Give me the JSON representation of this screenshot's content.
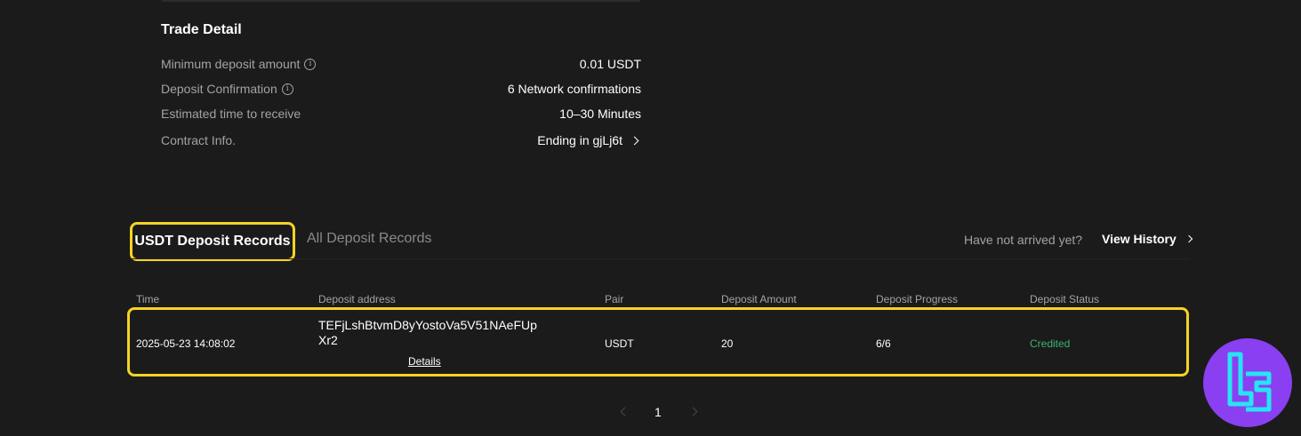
{
  "trade_detail": {
    "title": "Trade Detail",
    "rows": [
      {
        "label": "Minimum deposit amount",
        "value": "0.01 USDT"
      },
      {
        "label": "Deposit Confirmation",
        "value": "6 Network confirmations"
      },
      {
        "label": "Estimated time to receive",
        "value": "10–30 Minutes"
      },
      {
        "label": "Contract Info.",
        "value": "Ending in gjLj6t"
      }
    ]
  },
  "records": {
    "tabs": [
      {
        "label": "USDT Deposit Records",
        "active": true
      },
      {
        "label": "All Deposit Records",
        "active": false
      }
    ],
    "not_arrived_text": "Have not arrived yet?",
    "view_history_label": "View History",
    "columns": [
      "Time",
      "Deposit address",
      "Pair",
      "Deposit Amount",
      "Deposit Progress",
      "Deposit Status"
    ],
    "rows": [
      {
        "time": "2025-05-23 14:08:02",
        "address": "TEFjLshBtvmD8yYostoVa5V51NAeFUpXr2",
        "details_label": "Details",
        "pair": "USDT",
        "amount": "20",
        "progress": "6/6",
        "status": "Credited"
      }
    ]
  },
  "pagination": {
    "current_page": "1"
  },
  "colors": {
    "highlight": "#f5d323",
    "status_credited": "#3cb371",
    "logo_bg": "#8a3ff0",
    "logo_fg": "#27e4f5"
  },
  "icons": {
    "info": "info-icon",
    "chevron": "chevron-right-icon",
    "logo": "tradingfinder-logo"
  }
}
